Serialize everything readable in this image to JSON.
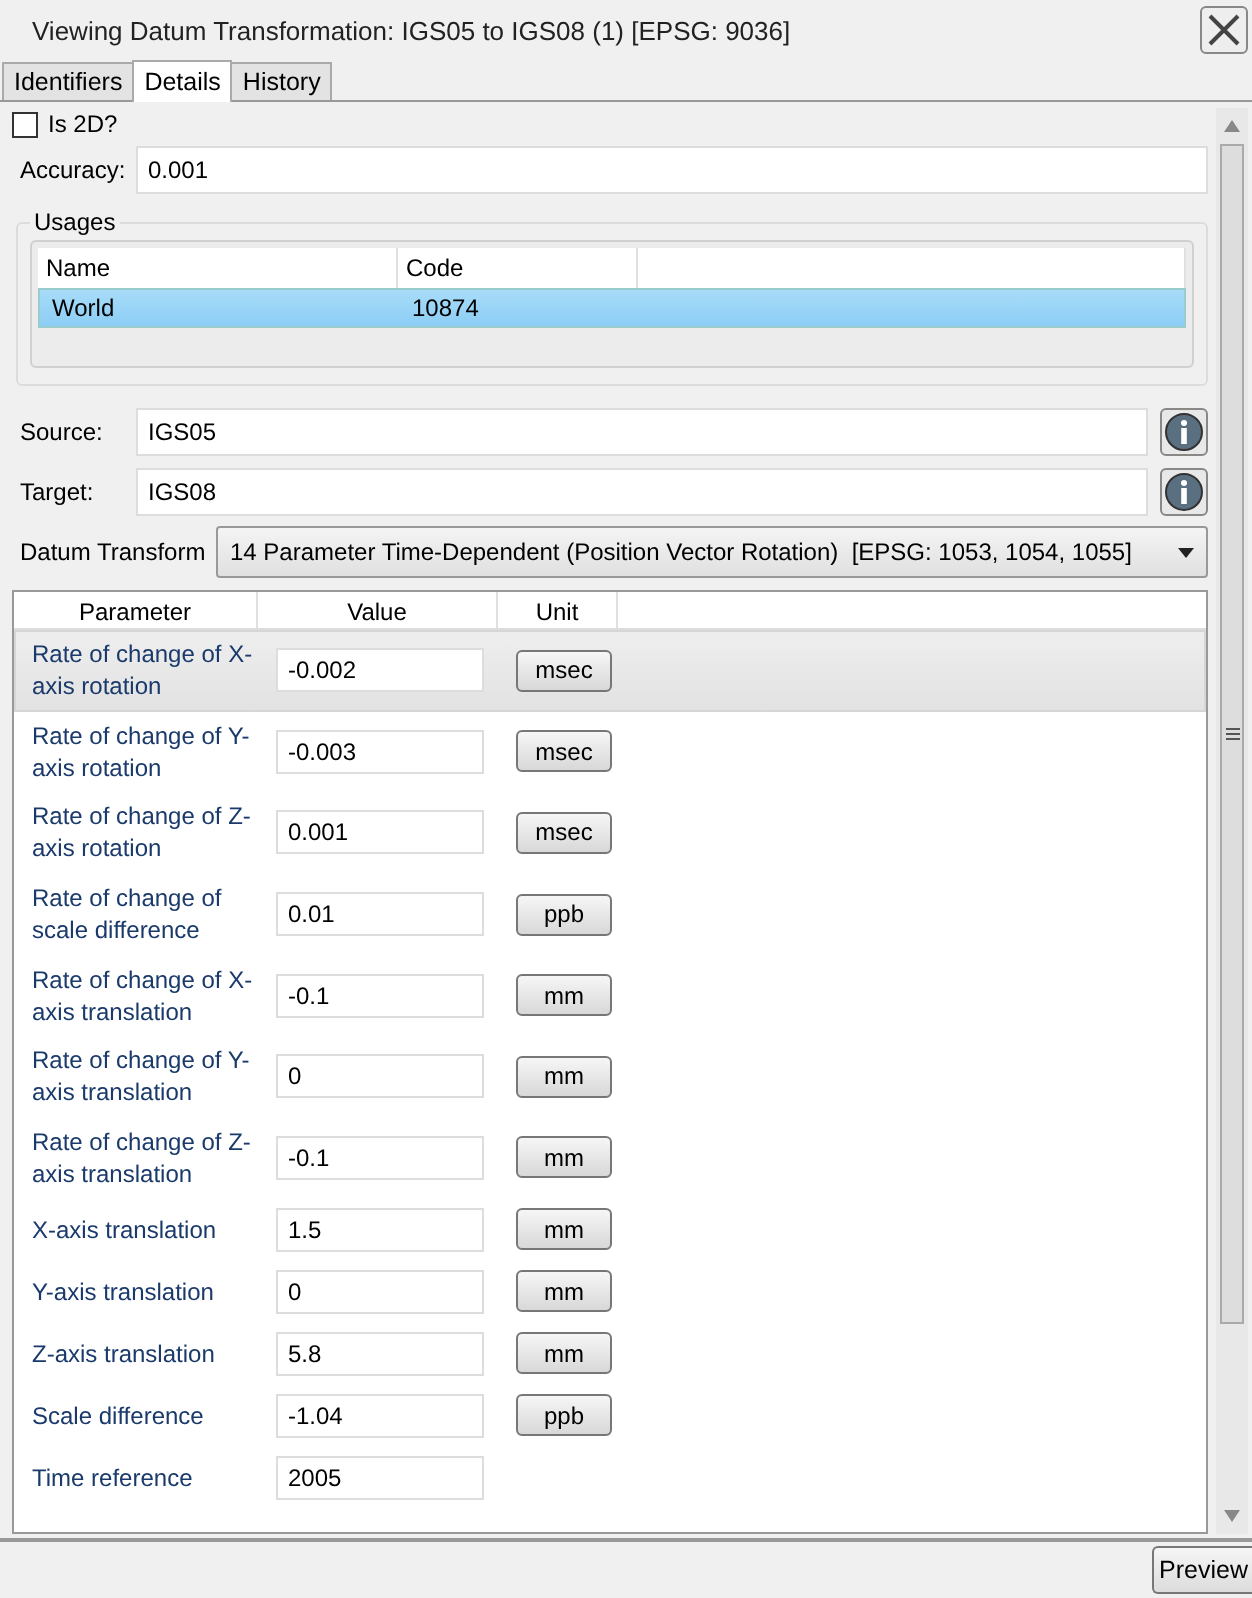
{
  "window": {
    "title": "Viewing Datum Transformation: IGS05 to IGS08 (1) [EPSG: 9036]"
  },
  "tabs": [
    {
      "label": "Identifiers",
      "selected": false
    },
    {
      "label": "Details",
      "selected": true
    },
    {
      "label": "History",
      "selected": false
    }
  ],
  "is_2d": {
    "label": "Is 2D?",
    "checked": false
  },
  "accuracy": {
    "label": "Accuracy:",
    "value": "0.001"
  },
  "usages": {
    "title": "Usages",
    "columns": [
      "Name",
      "Code"
    ],
    "rows": [
      {
        "name": "World",
        "code": "10874",
        "selected": true
      }
    ]
  },
  "source": {
    "label": "Source:",
    "value": "IGS05"
  },
  "target": {
    "label": "Target:",
    "value": "IGS08"
  },
  "datum_transform": {
    "label": "Datum Transform",
    "value": "14 Parameter Time-Dependent (Position Vector Rotation)  [EPSG: 1053, 1054, 1055]"
  },
  "parameters": {
    "columns": [
      "Parameter",
      "Value",
      "Unit"
    ],
    "rows": [
      {
        "name": "Rate of change of X-axis rotation",
        "value": "-0.002",
        "unit": "msec",
        "selected": true
      },
      {
        "name": "Rate of change of Y-axis rotation",
        "value": "-0.003",
        "unit": "msec",
        "selected": false
      },
      {
        "name": "Rate of change of Z-axis rotation",
        "value": "0.001",
        "unit": "msec",
        "selected": false
      },
      {
        "name": "Rate of change of scale difference",
        "value": "0.01",
        "unit": "ppb",
        "selected": false
      },
      {
        "name": "Rate of change of X-axis translation",
        "value": "-0.1",
        "unit": "mm",
        "selected": false
      },
      {
        "name": "Rate of change of Y-axis translation",
        "value": "0",
        "unit": "mm",
        "selected": false
      },
      {
        "name": "Rate of change of Z-axis translation",
        "value": "-0.1",
        "unit": "mm",
        "selected": false
      },
      {
        "name": "X-axis translation",
        "value": "1.5",
        "unit": "mm",
        "selected": false
      },
      {
        "name": "Y-axis translation",
        "value": "0",
        "unit": "mm",
        "selected": false
      },
      {
        "name": "Z-axis translation",
        "value": "5.8",
        "unit": "mm",
        "selected": false
      },
      {
        "name": "Scale difference",
        "value": "-1.04",
        "unit": "ppb",
        "selected": false
      },
      {
        "name": "Time reference",
        "value": "2005",
        "selected": false
      }
    ]
  },
  "buttons": [
    "Preview"
  ]
}
